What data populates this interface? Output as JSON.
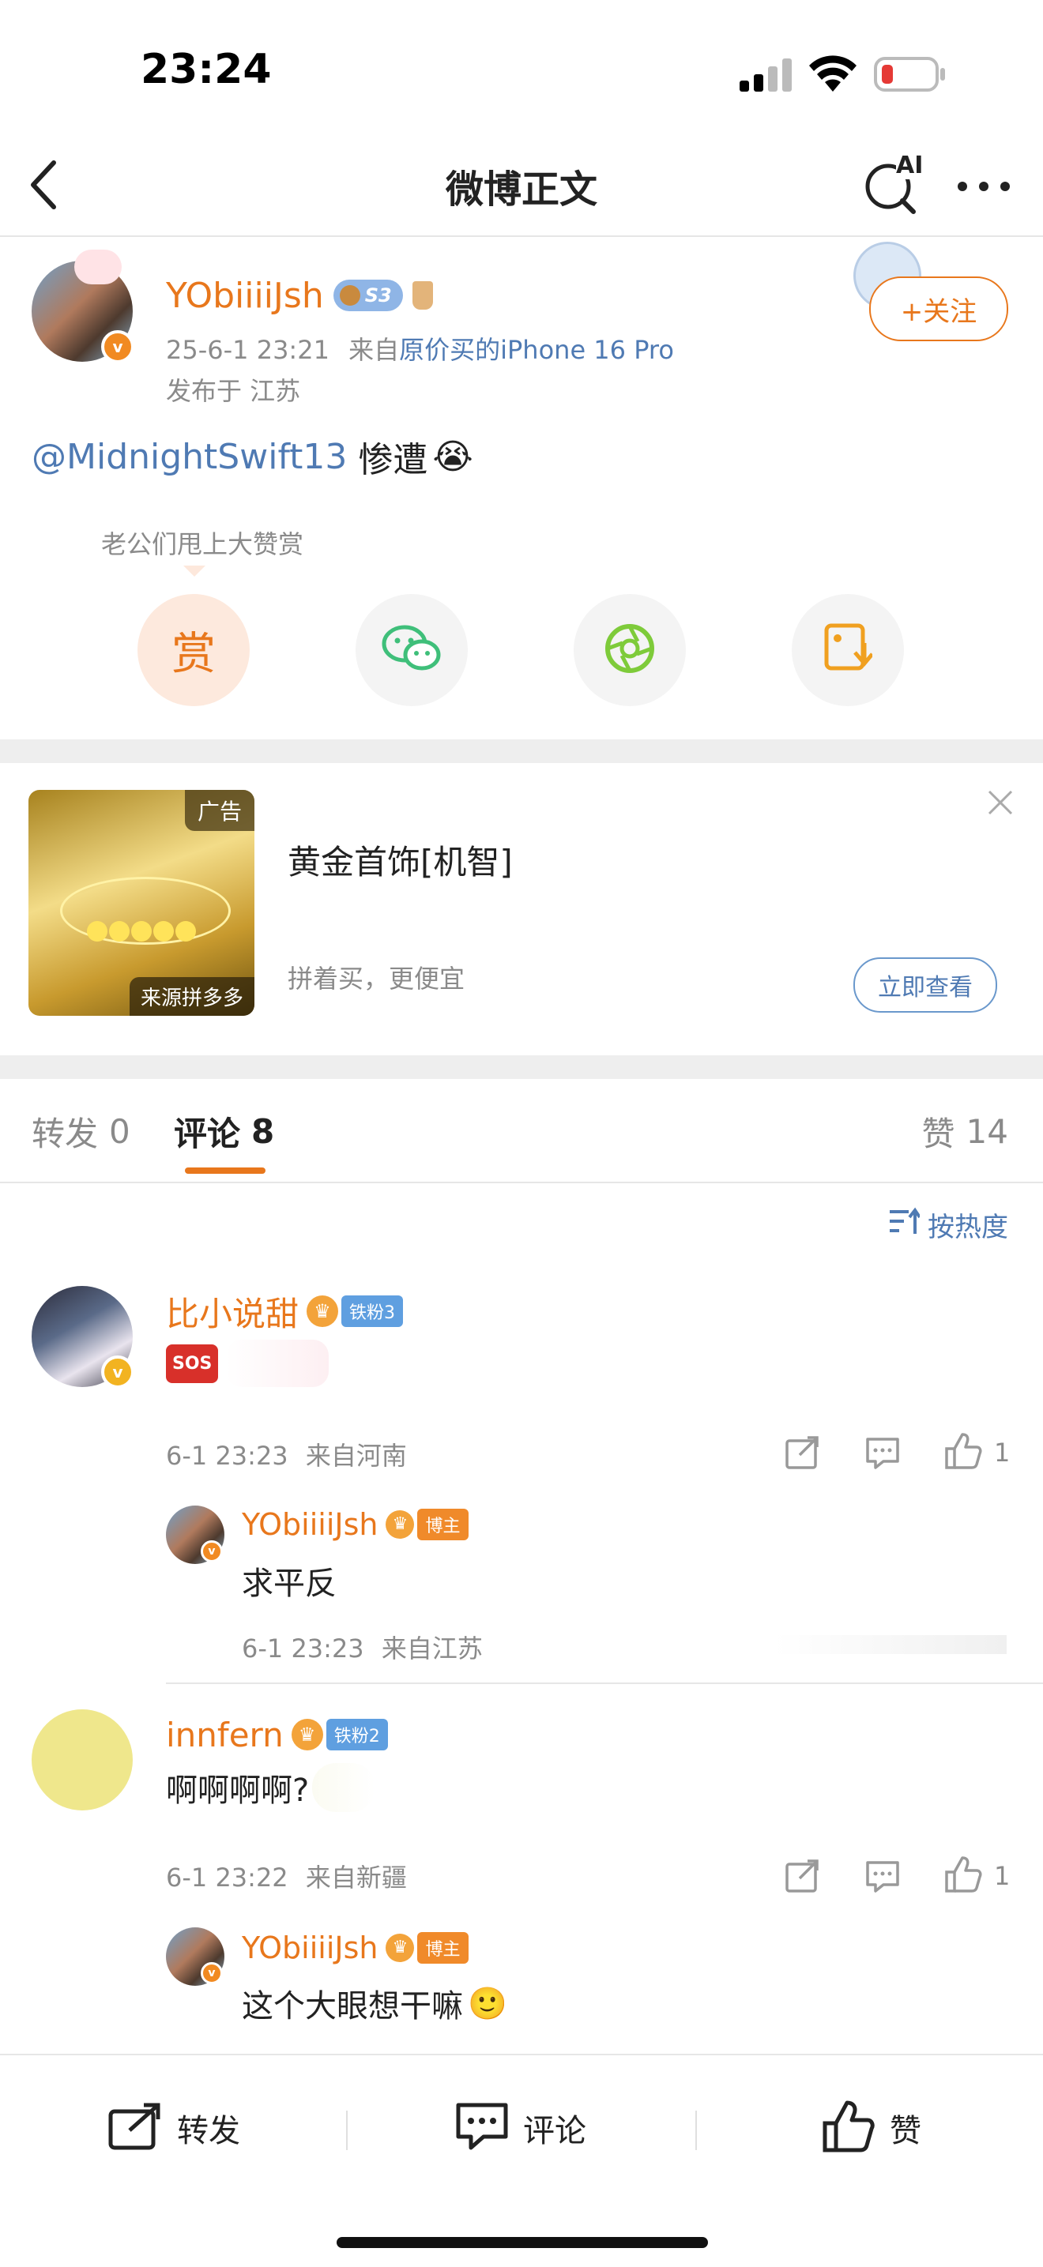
{
  "status_bar": {
    "time": "23:24"
  },
  "nav": {
    "title": "微博正文",
    "ai_label": "AI"
  },
  "post": {
    "author": "YObiiiiJsh",
    "level_badge": "S3",
    "meta_time": "25-6-1 23:21",
    "meta_from_prefix": "来自",
    "meta_device": "原价买的iPhone 16 Pro",
    "location": "发布于 江苏",
    "follow_label": "+关注",
    "mention": "@MidnightSwift13",
    "text": " 惨遭",
    "emoji": "😭",
    "reward_hint": "老公们甩上大赞赏",
    "reward_label": "赏"
  },
  "ad": {
    "tag": "广告",
    "source": "来源拼多多",
    "title": "黄金首饰[机智]",
    "subtitle": "拼着买，更便宜",
    "cta": "立即查看"
  },
  "tabs": {
    "repost": {
      "label": "转发",
      "count": "0"
    },
    "comment": {
      "label": "评论",
      "count": "8"
    },
    "like": {
      "label": "赞",
      "count": "14"
    },
    "sort_label": "按热度"
  },
  "comments": [
    {
      "author": "比小说甜",
      "fan_badge": "铁粉3",
      "text": "SOS",
      "time": "6-1 23:23",
      "location": "来自河南",
      "likes": "1",
      "reply": {
        "author": "YObiiiiJsh",
        "badge": "博主",
        "text": "求平反",
        "time": "6-1 23:23",
        "location": "来自江苏"
      }
    },
    {
      "author": "innfern",
      "fan_badge": "铁粉2",
      "text": "啊啊啊啊?",
      "time": "6-1 23:22",
      "location": "来自新疆",
      "likes": "1",
      "reply": {
        "author": "YObiiiiJsh",
        "badge": "博主",
        "text": "这个大眼想干嘛",
        "emoji": "🙂"
      }
    }
  ],
  "bottom_bar": {
    "repost": "转发",
    "comment": "评论",
    "like": "赞"
  },
  "colors": {
    "accent": "#e8771c",
    "link": "#4f7ab3",
    "muted": "#8a8a8a"
  }
}
